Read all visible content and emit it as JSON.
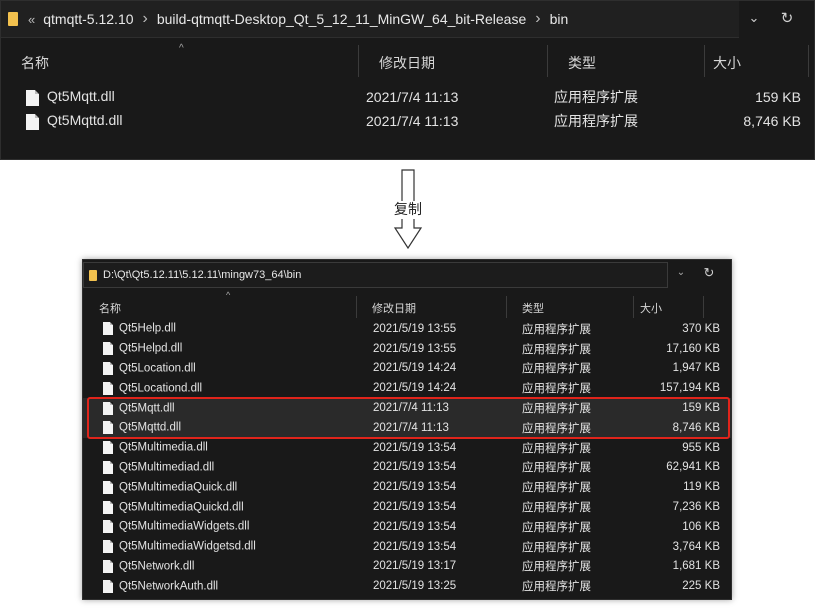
{
  "top_window": {
    "breadcrumb": {
      "overflow": "«",
      "parts": [
        "qtmqtt-5.12.10",
        "build-qtmqtt-Desktop_Qt_5_12_11_MinGW_64_bit-Release",
        "bin"
      ]
    },
    "headers": [
      "名称",
      "修改日期",
      "类型",
      "大小"
    ],
    "files": [
      {
        "name": "Qt5Mqtt.dll",
        "date": "2021/7/4 11:13",
        "type": "应用程序扩展",
        "size": "159 KB"
      },
      {
        "name": "Qt5Mqttd.dll",
        "date": "2021/7/4 11:13",
        "type": "应用程序扩展",
        "size": "8,746 KB"
      }
    ]
  },
  "arrow": {
    "label": "复制"
  },
  "bottom_window": {
    "path": "D:\\Qt\\Qt5.12.11\\5.12.11\\mingw73_64\\bin",
    "headers": [
      "名称",
      "修改日期",
      "类型",
      "大小"
    ],
    "files": [
      {
        "name": "Qt5Help.dll",
        "date": "2021/5/19 13:55",
        "type": "应用程序扩展",
        "size": "370 KB"
      },
      {
        "name": "Qt5Helpd.dll",
        "date": "2021/5/19 13:55",
        "type": "应用程序扩展",
        "size": "17,160 KB"
      },
      {
        "name": "Qt5Location.dll",
        "date": "2021/5/19 14:24",
        "type": "应用程序扩展",
        "size": "1,947 KB"
      },
      {
        "name": "Qt5Locationd.dll",
        "date": "2021/5/19 14:24",
        "type": "应用程序扩展",
        "size": "157,194 KB"
      },
      {
        "name": "Qt5Mqtt.dll",
        "date": "2021/7/4 11:13",
        "type": "应用程序扩展",
        "size": "159 KB"
      },
      {
        "name": "Qt5Mqttd.dll",
        "date": "2021/7/4 11:13",
        "type": "应用程序扩展",
        "size": "8,746 KB"
      },
      {
        "name": "Qt5Multimedia.dll",
        "date": "2021/5/19 13:54",
        "type": "应用程序扩展",
        "size": "955 KB"
      },
      {
        "name": "Qt5Multimediad.dll",
        "date": "2021/5/19 13:54",
        "type": "应用程序扩展",
        "size": "62,941 KB"
      },
      {
        "name": "Qt5MultimediaQuick.dll",
        "date": "2021/5/19 13:54",
        "type": "应用程序扩展",
        "size": "119 KB"
      },
      {
        "name": "Qt5MultimediaQuickd.dll",
        "date": "2021/5/19 13:54",
        "type": "应用程序扩展",
        "size": "7,236 KB"
      },
      {
        "name": "Qt5MultimediaWidgets.dll",
        "date": "2021/5/19 13:54",
        "type": "应用程序扩展",
        "size": "106 KB"
      },
      {
        "name": "Qt5MultimediaWidgetsd.dll",
        "date": "2021/5/19 13:54",
        "type": "应用程序扩展",
        "size": "3,764 KB"
      },
      {
        "name": "Qt5Network.dll",
        "date": "2021/5/19 13:17",
        "type": "应用程序扩展",
        "size": "1,681 KB"
      },
      {
        "name": "Qt5NetworkAuth.dll",
        "date": "2021/5/19 13:25",
        "type": "应用程序扩展",
        "size": "225 KB"
      }
    ],
    "highlighted": [
      "Qt5Mqtt.dll",
      "Qt5Mqttd.dll"
    ]
  },
  "colors": {
    "highlight_border": "#e0241b",
    "folder": "#f2c14e",
    "panel_bg": "#191919"
  },
  "icons": [
    "folder-icon",
    "chevron-down-icon",
    "refresh-icon",
    "file-icon",
    "chevron-right-icon",
    "down-arrow-icon"
  ]
}
